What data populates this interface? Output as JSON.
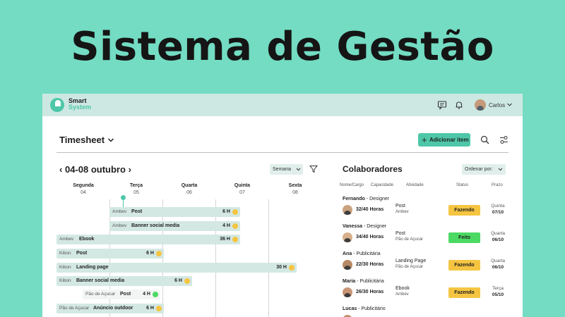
{
  "hero": {
    "title": "Sistema de Gestão"
  },
  "topbar": {
    "logo_line1": "Smart",
    "logo_line2": "System",
    "user_name": "Carlos"
  },
  "timesheet": {
    "title": "Timesheet",
    "add_label": "Adicionar item",
    "date_range": "04-08 outubro",
    "view_select": "Semana",
    "days": [
      {
        "name": "Segunda",
        "date": "04"
      },
      {
        "name": "Terça",
        "date": "05"
      },
      {
        "name": "Quarta",
        "date": "06"
      },
      {
        "name": "Quinta",
        "date": "07"
      },
      {
        "name": "Sexta",
        "date": "08"
      }
    ],
    "tasks": [
      {
        "client": "Ambev",
        "name": "Post",
        "hours": "6 H",
        "status_color": "#f5c542"
      },
      {
        "client": "Ambev",
        "name": "Banner social media",
        "hours": "4 H",
        "status_color": "#f5c542"
      },
      {
        "client": "Ambev",
        "name": "Ebook",
        "hours": "36 H",
        "status_color": "#f5c542"
      },
      {
        "client": "Kibon",
        "name": "Post",
        "hours": "6 H",
        "status_color": "#f5c542"
      },
      {
        "client": "Kibon",
        "name": "Landing page",
        "hours": "30 H",
        "status_color": "#f5c542"
      },
      {
        "client": "Kibon",
        "name": "Banner social media",
        "hours": "6 H",
        "status_color": "#f5c542"
      },
      {
        "client": "Pão de Açucar",
        "name": "Post",
        "hours": "4 H",
        "status_color": "#4cd964"
      },
      {
        "client": "Pão de Açucar",
        "name": "Anúncio outdoor",
        "hours": "6 H",
        "status_color": "#f5c542"
      }
    ]
  },
  "colab": {
    "title": "Colaboradores",
    "order_label": "Ordenar por:",
    "headers": {
      "name": "Nome/Cargo",
      "capacity": "Capacidade",
      "activity": "Atividade",
      "status": "Status",
      "due": "Prazo"
    },
    "people": [
      {
        "name": "Fernando",
        "role": " - Designer",
        "capacity": "32/40 Horas",
        "activity": "Post",
        "client": "Ambev",
        "status": "Fazendo",
        "status_color": "#f5c542",
        "due_day": "Quinta",
        "due_date": "07/10"
      },
      {
        "name": "Vanessa",
        "role": " - Designer",
        "capacity": "34/40 Horas",
        "activity": "Post",
        "client": "Pão de Açucar",
        "status": "Feito",
        "status_color": "#4cd964",
        "due_day": "Quarta",
        "due_date": "06/10"
      },
      {
        "name": "Ana",
        "role": " - Publicitária",
        "capacity": "22/30 Horas",
        "activity": "Landing Page",
        "client": "Pão de Açucar",
        "status": "Fazendo",
        "status_color": "#f5c542",
        "due_day": "Quarta",
        "due_date": "06/10"
      },
      {
        "name": "Maria",
        "role": " - Publicitária",
        "capacity": "26/30 Horas",
        "activity": "Ebook",
        "client": "Ambev",
        "status": "Fazendo",
        "status_color": "#f5c542",
        "due_day": "Terça",
        "due_date": "05/10"
      },
      {
        "name": "Lucas",
        "role": " - Publicitário",
        "capacity": "",
        "activity": "",
        "client": "",
        "status": "",
        "status_color": "#ffffff",
        "due_day": "",
        "due_date": ""
      }
    ]
  }
}
